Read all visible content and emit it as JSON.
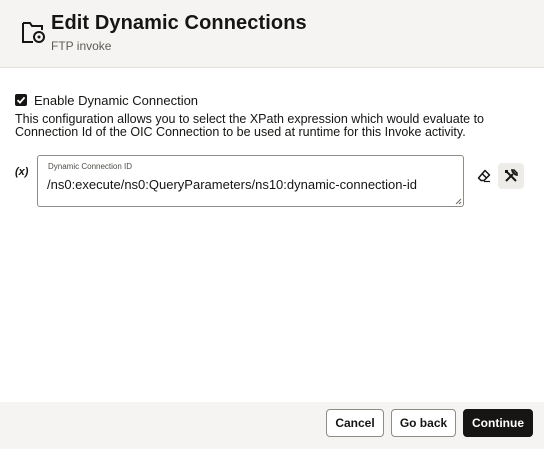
{
  "dialog": {
    "title": "Edit Dynamic Connections",
    "subtitle": "FTP invoke",
    "header_icon": "folder-connection-icon"
  },
  "option": {
    "checkbox_label": "Enable Dynamic Connection",
    "checked": true,
    "description": "This configuration allows you to select the XPath expression which would evaluate to Connection Id of the OIC Connection to be used at runtime for this Invoke activity."
  },
  "field": {
    "variable_marker": "(x)",
    "label": "Dynamic Connection ID",
    "value": "/ns0:execute/ns0:QueryParameters/ns10:dynamic-connection-id",
    "clear_icon": "eraser-icon",
    "mapper_icon": "mapper-tools-icon"
  },
  "footer": {
    "cancel_label": "Cancel",
    "back_label": "Go back",
    "continue_label": "Continue"
  },
  "colors": {
    "header_bg": "#f5f4f2",
    "primary_button": "#161513",
    "text": "#161513"
  }
}
